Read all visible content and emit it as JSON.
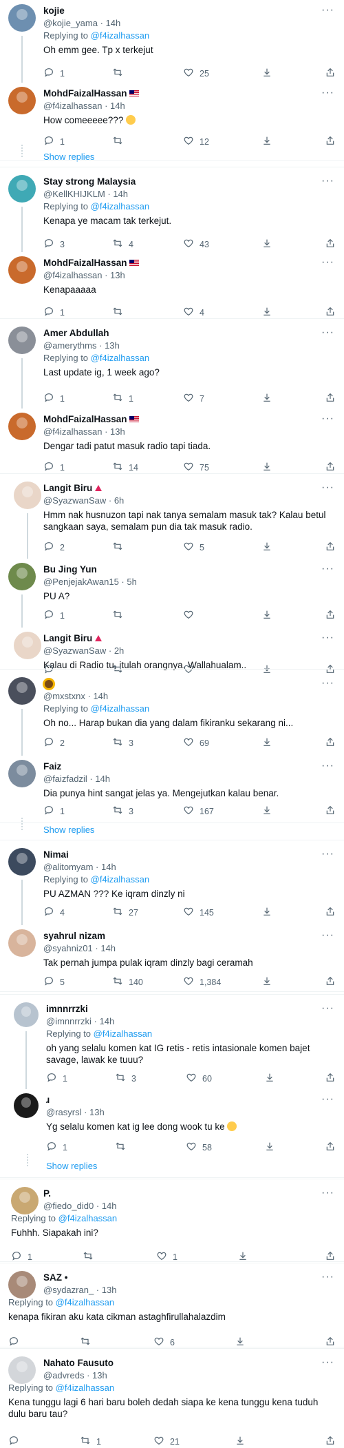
{
  "tweets": [
    {
      "name": "kojie",
      "handle": "@kojie_yama",
      "time": "14h",
      "replying": "Replying to",
      "reply_to": "@f4izalhassan",
      "text": "Oh emm gee. Tp x terkejut",
      "replies": "1",
      "retweets": "",
      "likes": "25",
      "avatar": "#6d8fb0"
    },
    {
      "name": "MohdFaizalHassan",
      "handle": "@f4izalhassan",
      "time": "14h",
      "text": "How comeeeee???",
      "replies": "1",
      "retweets": "",
      "likes": "12",
      "avatar": "#c96a2c"
    },
    {
      "show_replies": "Show replies"
    },
    {
      "name": "Stay strong Malaysia",
      "handle": "@KellKHIJKLM",
      "time": "14h",
      "replying": "Replying to",
      "reply_to": "@f4izalhassan",
      "text": "Kenapa ye macam tak terkejut.",
      "replies": "3",
      "retweets": "4",
      "likes": "43",
      "avatar": "#3fa9b5"
    },
    {
      "name": "MohdFaizalHassan",
      "handle": "@f4izalhassan",
      "time": "13h",
      "text": "Kenapaaaaa",
      "replies": "1",
      "retweets": "",
      "likes": "4",
      "avatar": "#c96a2c"
    },
    {
      "name": "Amer Abdullah",
      "handle": "@amerythms",
      "time": "13h",
      "replying": "Replying to",
      "reply_to": "@f4izalhassan",
      "text": "Last update ig, 1 week ago?",
      "replies": "1",
      "retweets": "1",
      "likes": "7",
      "avatar": "#8a8f98"
    },
    {
      "name": "MohdFaizalHassan",
      "handle": "@f4izalhassan",
      "time": "13h",
      "text": "Dengar tadi patut masuk radio tapi tiada.",
      "replies": "1",
      "retweets": "14",
      "likes": "75",
      "avatar": "#c96a2c"
    },
    {
      "name": "Langit Biru",
      "handle": "@SyazwanSaw",
      "time": "6h",
      "text": "Hmm nak husnuzon tapi nak tanya semalam masuk tak? Kalau betul sangkaan saya, semalam pun dia tak masuk radio.",
      "replies": "2",
      "retweets": "",
      "likes": "5",
      "avatar": "#e9d6c8"
    },
    {
      "name": "Bu Jing Yun",
      "handle": "@PenjejakAwan15",
      "time": "5h",
      "text": "PU A?",
      "replies": "1",
      "retweets": "",
      "likes": "",
      "avatar": "#6e8a4c"
    },
    {
      "name": "Langit Biru",
      "handle": "@SyazwanSaw",
      "time": "2h",
      "text": "Kalau di Radio tu, itulah orangnya. Wallahualam..",
      "replies": "",
      "retweets": "",
      "likes": "",
      "avatar": "#e9d6c8"
    },
    {
      "name": "",
      "handle": "@mxstxnx",
      "time": "14h",
      "replying": "Replying to",
      "reply_to": "@f4izalhassan",
      "text": "Oh no... Harap bukan dia yang dalam fikiranku sekarang ni...",
      "replies": "2",
      "retweets": "3",
      "likes": "69",
      "avatar": "#4a4f5c"
    },
    {
      "name": "Faiz",
      "handle": "@faizfadzil",
      "time": "14h",
      "text": "Dia punya hint sangat jelas ya. Mengejutkan kalau benar.",
      "replies": "1",
      "retweets": "3",
      "likes": "167",
      "avatar": "#7c8c9e"
    },
    {
      "show_replies": "Show replies"
    },
    {
      "name": "Nimai",
      "handle": "@alitomyam",
      "time": "14h",
      "replying": "Replying to",
      "reply_to": "@f4izalhassan",
      "text": "PU AZMAN ??? Ke iqram dinzly ni",
      "replies": "4",
      "retweets": "27",
      "likes": "145",
      "avatar": "#3c4a5e"
    },
    {
      "name": "syahrul nizam",
      "handle": "@syahniz01",
      "time": "14h",
      "text": "Tak pernah jumpa pulak iqram dinzly bagi ceramah",
      "replies": "5",
      "retweets": "140",
      "likes": "1,384",
      "avatar": "#d8b49c"
    },
    {
      "name": "imnnrrzki",
      "handle": "@imnnrrzki",
      "time": "14h",
      "replying": "Replying to",
      "reply_to": "@f4izalhassan",
      "text": "oh yang selalu komen kat IG retis - retis intasionale komen bajet savage, lawak ke tuuu?",
      "replies": "1",
      "retweets": "3",
      "likes": "60",
      "avatar": "#b7c3cf"
    },
    {
      "name": "ɹ",
      "handle": "@rasyrsl",
      "time": "13h",
      "text": "Yg selalu komen kat ig lee dong wook tu ke",
      "replies": "1",
      "retweets": "",
      "likes": "58",
      "avatar": "#1a1a1a"
    },
    {
      "show_replies": "Show replies"
    },
    {
      "name": "P.",
      "handle": "@fiedo_did0",
      "time": "14h",
      "replying": "Replying to",
      "reply_to": "@f4izalhassan",
      "text": "Fuhhh. Siapakah ini?",
      "replies": "1",
      "retweets": "",
      "likes": "1",
      "avatar": "#c9a872"
    },
    {
      "name": "SAZ •",
      "handle": "@sydazran_",
      "time": "13h",
      "replying": "Replying to",
      "reply_to": "@f4izalhassan",
      "text": "kenapa fikiran aku kata cikman astaghfirullahalazdim",
      "replies": "",
      "retweets": "",
      "likes": "6",
      "avatar": "#a88a78"
    },
    {
      "name": "Nahato Fausuto",
      "handle": "@advreds",
      "time": "13h",
      "replying": "Replying to",
      "reply_to": "@f4izalhassan",
      "text": "Kena tunggu lagi 6 hari baru boleh dedah siapa ke kena tunggu kena tuduh dulu baru tau?",
      "replies": "",
      "retweets": "1",
      "likes": "21",
      "avatar": "#d3d6da"
    }
  ],
  "more_icon": "···",
  "colors": {
    "link": "#1d9bf0",
    "muted": "#536471",
    "line": "#cfd9de"
  }
}
